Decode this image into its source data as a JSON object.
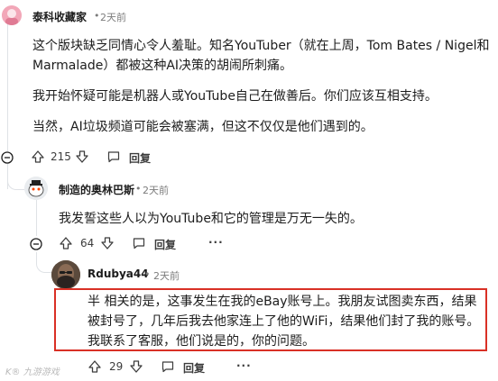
{
  "comment1": {
    "author": "泰科收藏家",
    "separator": "•",
    "time": "2天前",
    "paragraphs": [
      "这个版块缺乏同情心令人羞耻。知名YouTuber（就在上周，Tom Bates / Nigel和",
      "Marmalade）都被这种AI决策的胡闹所刺痛。",
      "我开始怀疑可能是机器人或YouTube自己在做善后。你们应该互相支持。",
      "当然，AI垃圾频道可能会被塞满，但这不仅仅是他们遇到的。"
    ],
    "votes": "215",
    "reply_label": "回复",
    "more_label": "···"
  },
  "comment2": {
    "author": "制造的奥林巴斯",
    "separator": "•",
    "time": "2天前",
    "paragraphs": [
      "我发誓这些人以为YouTube和它的管理是万无一失的。"
    ],
    "votes": "64",
    "reply_label": "回复",
    "more_label": "···"
  },
  "comment3": {
    "author": "Rdubya44",
    "separator": "•",
    "time": "2天前",
    "paragraphs": [
      "半 相关的是，这事发生在我的eBay账号上。我朋友试图卖东西，结果",
      "被封号了，几年后我去他家连上了他的WiFi，结果他们封了我的账号。",
      "我联系了客服，他们说是的，你的问题。"
    ],
    "votes": "29",
    "reply_label": "回复",
    "more_label": "···"
  },
  "watermark": "K® 九游游戏",
  "colors": {
    "highlight": "#d93025",
    "thread_line": "#dfe2e6",
    "text": "#1c1c1c",
    "muted": "#7c7c7c"
  }
}
